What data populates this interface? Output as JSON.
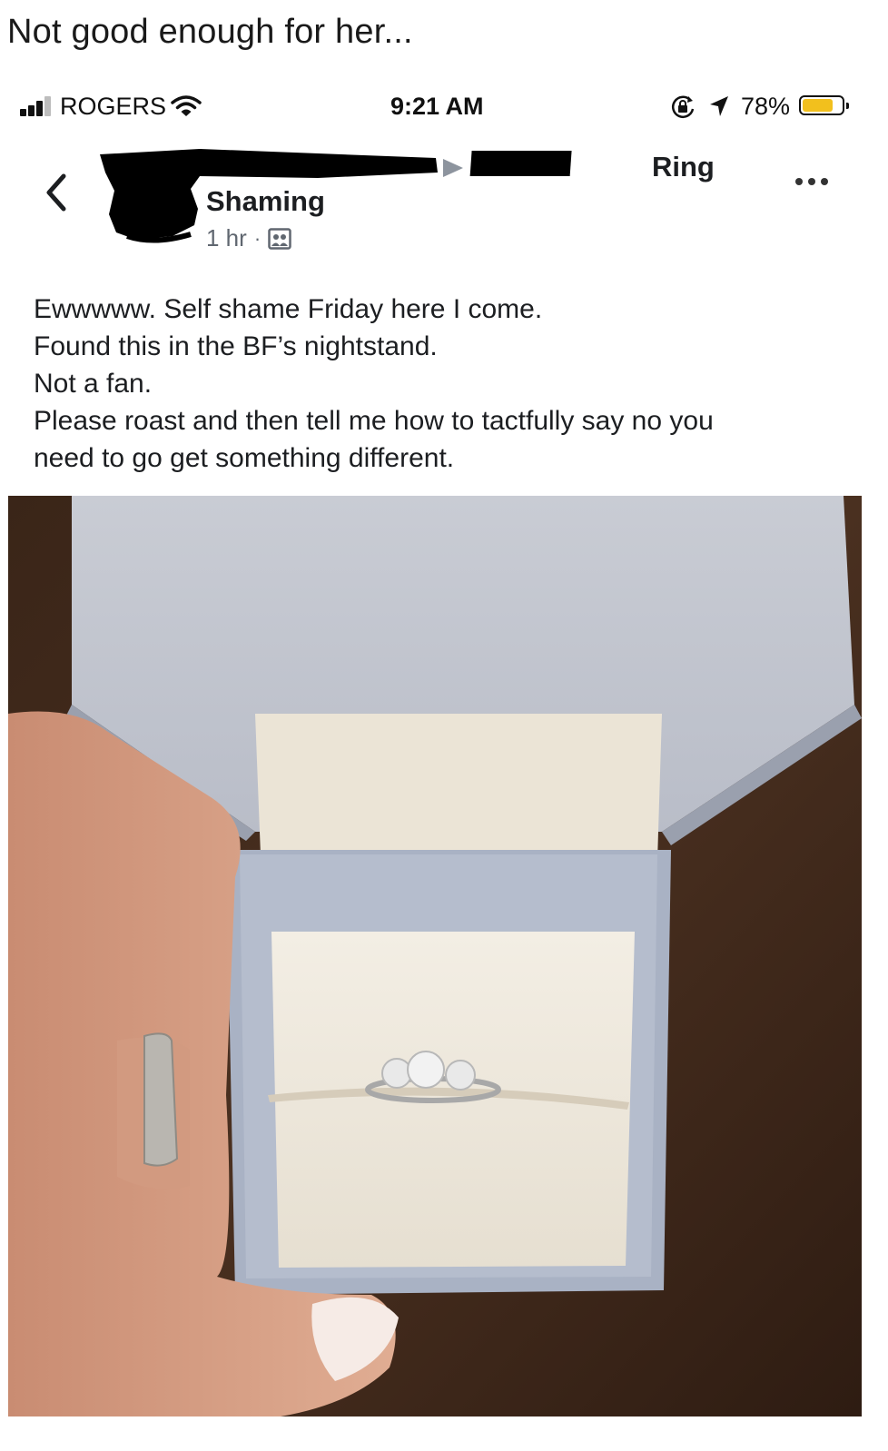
{
  "caption": "Not good enough for her...",
  "status_bar": {
    "carrier": "ROGERS",
    "time": "9:21 AM",
    "battery": "78%",
    "battery_level": 0.78,
    "icons": [
      "signal-icon",
      "wifi-icon",
      "rotation-lock-icon",
      "location-icon",
      "battery-icon"
    ]
  },
  "post": {
    "target": "Ring",
    "group": "Shaming",
    "time": "1 hr",
    "audience_icon": "group-photo-icon",
    "lines": [
      "Ewwwww. Self shame Friday here I come.",
      "Found this in the BF’s nightstand.",
      "Not a fan.",
      "Please roast and then tell me how to tactfully say no you",
      "need to go get something different."
    ]
  },
  "colors": {
    "text": "#1c1e21",
    "meta": "#606770",
    "battery_fill": "#f2c01d",
    "box_lid": "#c4c8d2",
    "cushion": "#efe9de"
  }
}
